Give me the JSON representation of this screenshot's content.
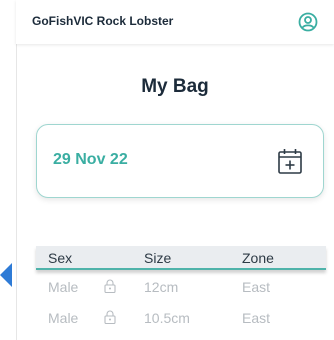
{
  "app": {
    "title": "GoFishVIC Rock Lobster"
  },
  "header": {
    "account_icon": "account-circle-icon"
  },
  "page": {
    "title": "My Bag"
  },
  "date_card": {
    "date": "29 Nov 22",
    "icon": "calendar-add-icon"
  },
  "table": {
    "columns": [
      "Sex",
      "Size",
      "Zone"
    ],
    "rows": [
      {
        "sex": "Male",
        "size": "12cm",
        "zone": "East",
        "icon": "lock-icon"
      },
      {
        "sex": "Male",
        "size": "10.5cm",
        "zone": "East",
        "icon": "lock-icon"
      }
    ]
  },
  "colors": {
    "accent": "#3aaea2",
    "header_underline": "#4fb3aa",
    "back_arrow": "#2e7bd6",
    "muted_text": "#b7bcc1",
    "title_text": "#1c2b3a"
  }
}
